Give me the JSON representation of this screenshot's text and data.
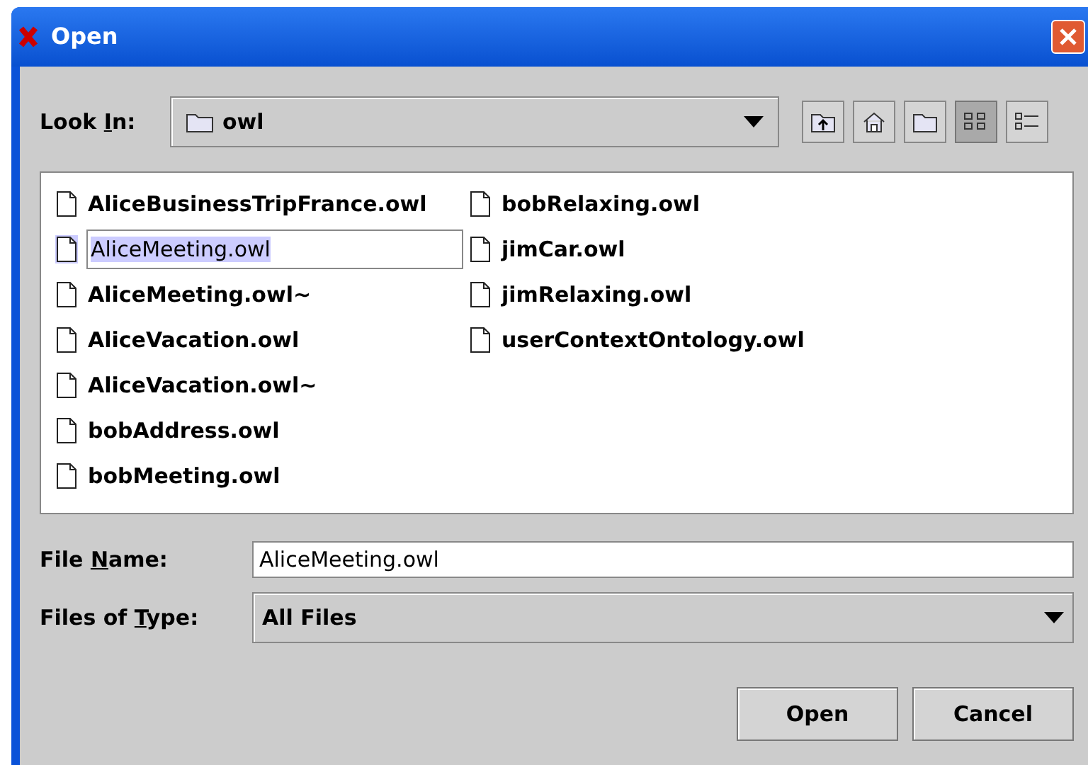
{
  "window": {
    "title": "Open"
  },
  "look_in": {
    "label_parts": [
      "Look ",
      "I",
      "n:"
    ],
    "value": "owl"
  },
  "toolbar": [
    {
      "kind": "up",
      "selected": false
    },
    {
      "kind": "home",
      "selected": false
    },
    {
      "kind": "new-folder",
      "selected": false
    },
    {
      "kind": "list",
      "selected": true
    },
    {
      "kind": "details",
      "selected": false
    }
  ],
  "files": [
    [
      {
        "name": "AliceBusinessTripFrance.owl",
        "selected": false
      },
      {
        "name": "AliceMeeting.owl",
        "selected": true
      },
      {
        "name": "AliceMeeting.owl~",
        "selected": false
      },
      {
        "name": "AliceVacation.owl",
        "selected": false
      },
      {
        "name": "AliceVacation.owl~",
        "selected": false
      },
      {
        "name": "bobAddress.owl",
        "selected": false
      },
      {
        "name": "bobMeeting.owl",
        "selected": false
      }
    ],
    [
      {
        "name": "bobRelaxing.owl",
        "selected": false
      },
      {
        "name": "jimCar.owl",
        "selected": false
      },
      {
        "name": "jimRelaxing.owl",
        "selected": false
      },
      {
        "name": "userContextOntology.owl",
        "selected": false
      }
    ]
  ],
  "file_name": {
    "label_parts": [
      "File ",
      "N",
      "ame:"
    ],
    "value": "AliceMeeting.owl"
  },
  "file_type": {
    "label_parts": [
      "Files of ",
      "T",
      "ype:"
    ],
    "value": "All Files"
  },
  "buttons": [
    "Open",
    "Cancel"
  ]
}
